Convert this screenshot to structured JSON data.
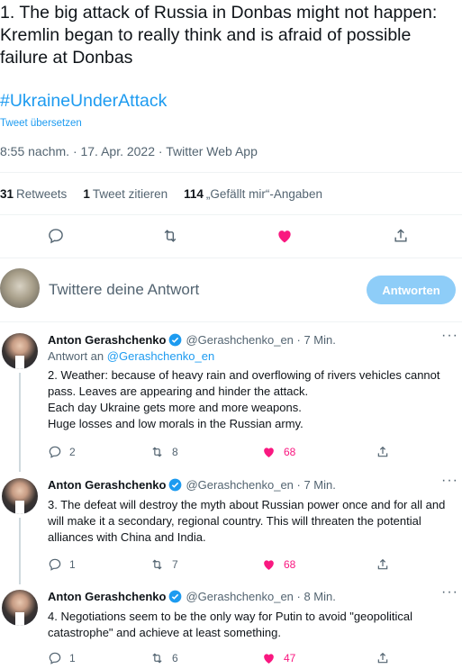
{
  "tweet": {
    "text": "1. The big attack of Russia in Donbas might not happen: Kremlin began to really think and is afraid of possible failure at Donbas",
    "hashtag": "#UkraineUnderAttack",
    "translate": "Tweet übersetzen",
    "meta": "8:55 nachm. · 17. Apr. 2022 · Twitter Web App",
    "stats": {
      "retweets_count": "31",
      "retweets_label": "Retweets",
      "quotes_count": "1",
      "quotes_label": "Tweet zitieren",
      "likes_count": "114",
      "likes_label": "„Gefällt mir“-Angaben"
    },
    "actions": [
      "reply-icon",
      "retweet-icon",
      "like-icon",
      "share-icon"
    ]
  },
  "compose": {
    "placeholder": "Twittere deine Antwort",
    "button": "Antworten"
  },
  "replies": [
    {
      "name": "Anton Gerashchenko",
      "handle": "@Gerashchenko_en · 7 Min.",
      "replying_to_prefix": "Antwort an",
      "replying_to": "@Gerashchenko_en",
      "lines": [
        "2. Weather: because of heavy rain and overflowing of rivers vehicles cannot pass. Leaves are appearing and hinder the attack.",
        "Each day Ukraine gets more and more weapons.",
        "Huge losses and low morals in the Russian army."
      ],
      "replies": "2",
      "retweets": "8",
      "likes": "68"
    },
    {
      "name": "Anton Gerashchenko",
      "handle": "@Gerashchenko_en · 7 Min.",
      "lines": [
        "3. The defeat will destroy the myth about Russian power once and for all and will make it a secondary, regional country. This will threaten the potential alliances with China and India."
      ],
      "replies": "1",
      "retweets": "7",
      "likes": "68"
    },
    {
      "name": "Anton Gerashchenko",
      "handle": "@Gerashchenko_en · 8 Min.",
      "lines": [
        "4. Negotiations seem to be the only way for Putin to avoid \"geopolitical catastrophe\" and achieve at least something."
      ],
      "replies": "1",
      "retweets": "6",
      "likes": "47"
    }
  ],
  "colors": {
    "accent": "#1d9bf0",
    "like": "#f91880",
    "muted": "#536471",
    "button": "#8ecdf8"
  }
}
